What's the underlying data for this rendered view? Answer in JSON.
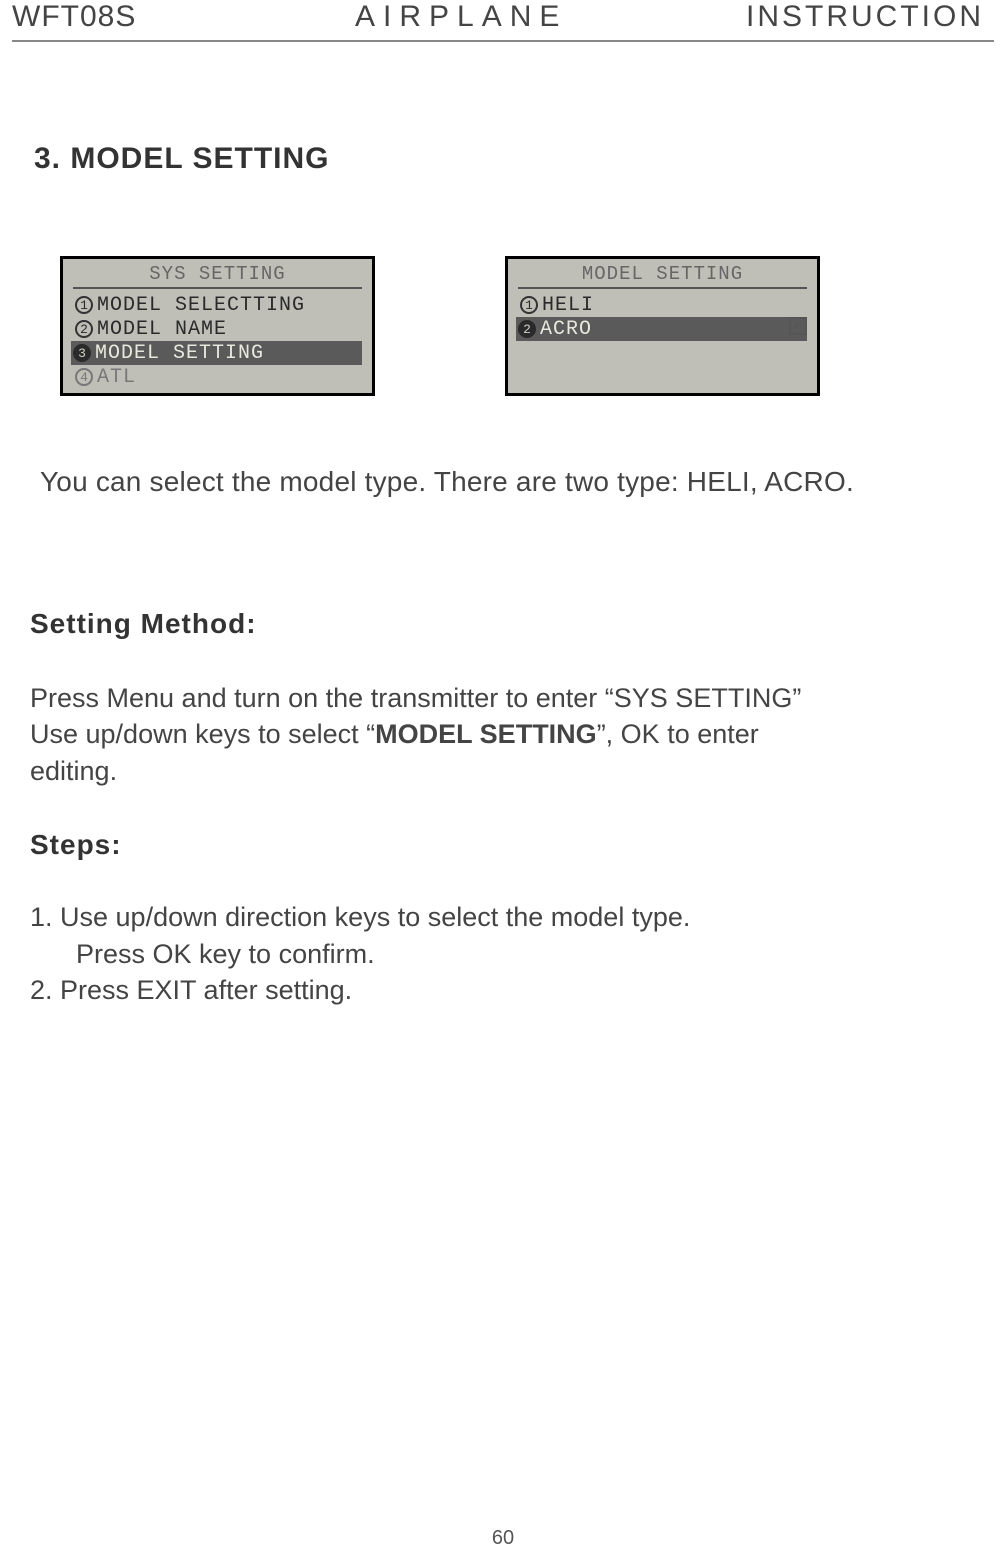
{
  "header": {
    "left": "WFT08S",
    "center": "AIRPLANE",
    "right": "INSTRUCTION"
  },
  "section_title": "3. MODEL SETTING",
  "lcd_left": {
    "title": "SYS SETTING",
    "items": [
      {
        "num": "1",
        "label": "MODEL SELECTTING",
        "selected": false,
        "dim": false
      },
      {
        "num": "2",
        "label": "MODEL NAME",
        "selected": false,
        "dim": false
      },
      {
        "num": "3",
        "label": "MODEL SETTING",
        "selected": true,
        "dim": false
      },
      {
        "num": "4",
        "label": "ATL",
        "selected": false,
        "dim": true
      }
    ]
  },
  "lcd_right": {
    "title": "MODEL SETTING",
    "items": [
      {
        "num": "1",
        "label": "HELI",
        "selected": false
      },
      {
        "num": "2",
        "label": "ACRO",
        "selected": true
      }
    ],
    "check": "✓"
  },
  "intro": "You can select the model type. There are two type: HELI, ACRO.",
  "method_title": "Setting Method:",
  "method_line1a": "Press Menu and turn on the transmitter to enter “SYS SETTING”",
  "method_line2a": "Use up/down keys to select “",
  "method_line2b_bold": "MODEL SETTING",
  "method_line2c": "”, OK to enter",
  "method_line3": "editing.",
  "steps_title": "Steps:",
  "step1a": "1. Use up/down direction keys to select the model type.",
  "step1b": "Press OK key to confirm.",
  "step2": "2. Press EXIT after setting.",
  "page_number": "60"
}
